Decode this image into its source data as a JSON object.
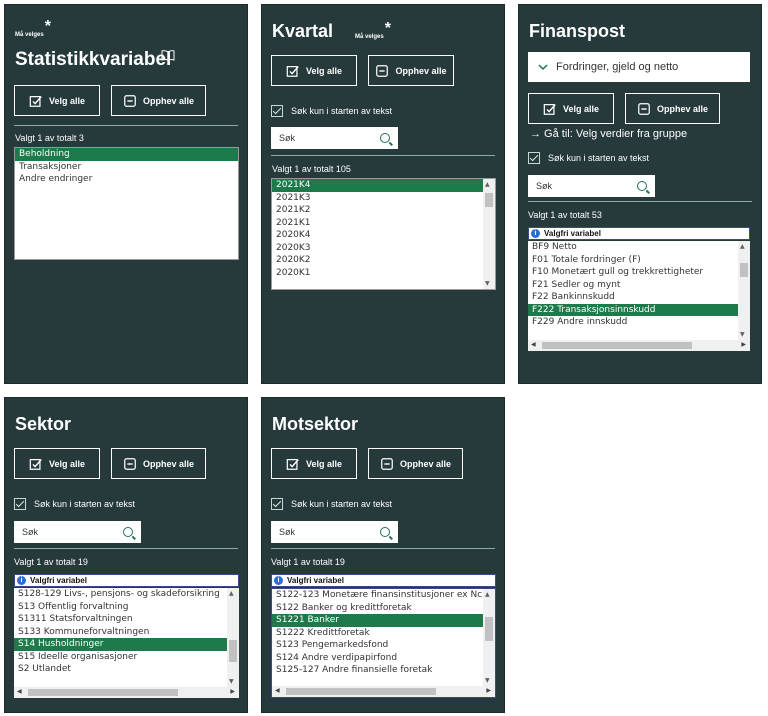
{
  "common": {
    "select_all": "Velg alle",
    "deselect_all": "Opphev alle",
    "search_start_label": "Søk kun i starten av tekst",
    "search_placeholder": "Søk",
    "required_label": "Må velges",
    "required_star": "*",
    "optional_variable": "Valgfri variabel"
  },
  "panels": {
    "statistikk": {
      "title": "Statistikkvariabel",
      "count": "Valgt 1 av totalt 3",
      "items": [
        "Beholdning",
        "Transaksjoner",
        "Andre endringer"
      ],
      "selected": 0
    },
    "kvartal": {
      "title": "Kvartal",
      "count": "Valgt 1 av totalt 105",
      "items": [
        "2021K4",
        "2021K3",
        "2021K2",
        "2021K1",
        "2020K4",
        "2020K3",
        "2020K2",
        "2020K1"
      ],
      "selected": 0
    },
    "finanspost": {
      "title": "Finanspost",
      "dropdown": "Fordringer, gjeld og netto",
      "goto": "→ Gå til: Velg verdier fra gruppe",
      "count": "Valgt 1 av totalt 53",
      "items": [
        "BF9 Netto",
        "F01 Totale fordringer (F)",
        "F10 Monetært gull og trekkrettigheter",
        "F21 Sedler og mynt",
        "F22 Bankinnskudd",
        "F222 Transaksjonsinnskudd",
        "F229 Andre innskudd"
      ],
      "selected": 5
    },
    "sektor": {
      "title": "Sektor",
      "count": "Valgt 1 av totalt 19",
      "items": [
        "S128-129 Livs-, pensjons- og skadeforsikring",
        "S13 Offentlig forvaltning",
        "S1311 Statsforvaltningen",
        "S133 Kommuneforvaltningen",
        "S14 Husholdninger",
        "S15 Ideelle organisasjoner",
        "S2 Utlandet"
      ],
      "selected": 4
    },
    "motsektor": {
      "title": "Motsektor",
      "count": "Valgt 1 av totalt 19",
      "items": [
        "S122-123 Monetære finansinstitusjoner ex Nc",
        "S122 Banker og kredittforetak",
        "S1221 Banker",
        "S1222 Kredittforetak",
        "S123 Pengemarkedsfond",
        "S124 Andre verdipapirfond",
        "S125-127 Andre finansielle foretak"
      ],
      "selected": 2
    }
  },
  "colors": {
    "panel_bg": "#26393b",
    "selected_bg": "#1e7a4a",
    "accent": "#1e6f5c"
  }
}
